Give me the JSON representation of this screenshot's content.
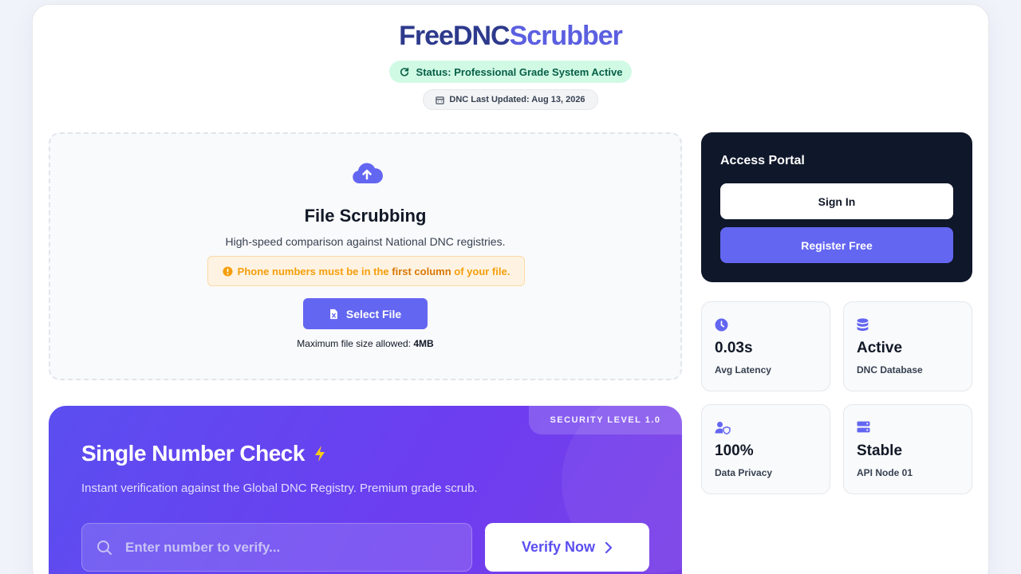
{
  "brand": {
    "part1": "FreeDNC",
    "part2": "Scrubber"
  },
  "status": {
    "text": "Status: Professional Grade System Active",
    "icon": "sync-icon"
  },
  "updated": {
    "text": "DNC Last Updated: Aug 13, 2026",
    "icon": "calendar-icon"
  },
  "upload": {
    "icon": "cloud-upload-icon",
    "title": "File Scrubbing",
    "subtitle": "High-speed comparison against National DNC registries.",
    "warning_pre": "Phone numbers must be in the ",
    "warning_bold": "first column",
    "warning_post": " of your file.",
    "button_label": "Select File",
    "max_size_label": "Maximum file size allowed: ",
    "max_size_value": "4MB"
  },
  "single_check": {
    "badge": "SECURITY LEVEL 1.0",
    "title": "Single Number Check",
    "subtitle": "Instant verification against the Global DNC Registry. Premium grade scrub.",
    "input_placeholder": "Enter number to verify...",
    "button_label": "Verify Now"
  },
  "portal": {
    "title": "Access Portal",
    "signin_label": "Sign In",
    "register_label": "Register Free"
  },
  "stats": [
    {
      "icon": "clock-icon",
      "value": "0.03s",
      "label": "Avg Latency"
    },
    {
      "icon": "database-icon",
      "value": "Active",
      "label": "DNC Database"
    },
    {
      "icon": "user-shield-icon",
      "value": "100%",
      "label": "Data Privacy"
    },
    {
      "icon": "server-icon",
      "value": "Stable",
      "label": "API Node 01"
    }
  ],
  "colors": {
    "accent": "#6366f1",
    "status_bg": "#d1fae5",
    "warning": "#f59e0b",
    "portal_bg": "#0f172a"
  }
}
